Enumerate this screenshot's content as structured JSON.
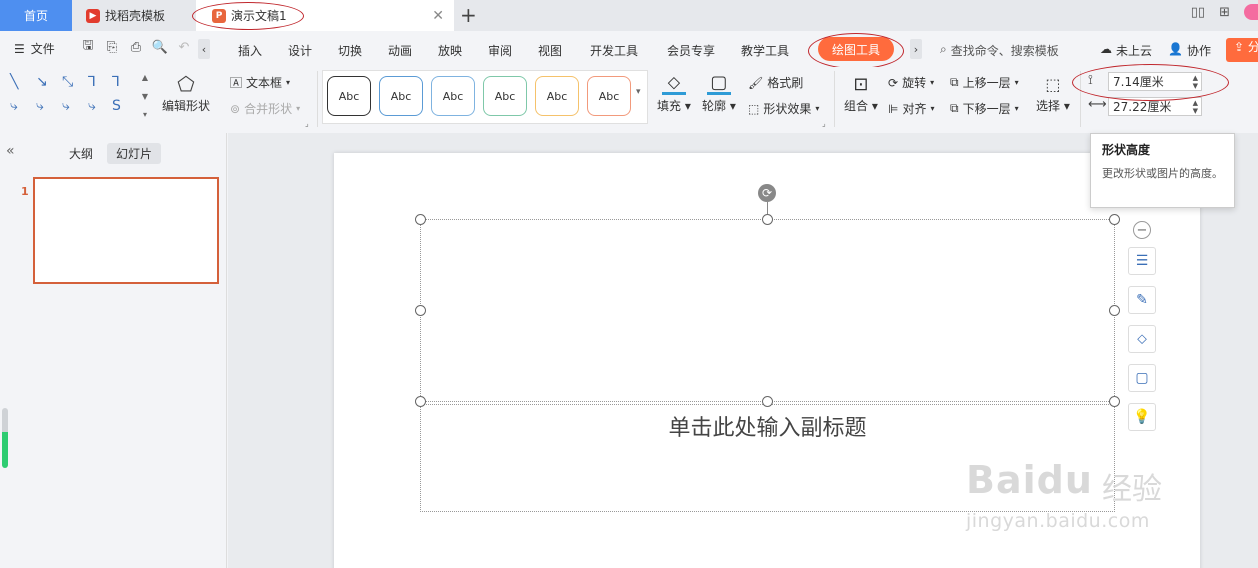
{
  "tabs": {
    "home": "首页",
    "template_tab": "找稻壳模板",
    "doc_tab": "演示文稿1"
  },
  "menu": {
    "file": "文件",
    "items": [
      "插入",
      "设计",
      "切换",
      "动画",
      "放映",
      "审阅",
      "视图",
      "开发工具",
      "会员专享",
      "教学工具"
    ],
    "active": "绘图工具",
    "search": "查找命令、搜索模板",
    "cloud": "未上云",
    "coop": "协作",
    "share": "分"
  },
  "ribbon": {
    "edit_shape": "编辑形状",
    "text_box": "文本框",
    "merge_shape": "合并形状",
    "style_labels": [
      "Abc",
      "Abc",
      "Abc",
      "Abc",
      "Abc",
      "Abc"
    ],
    "style_colors": [
      "#333333",
      "#5b9bd5",
      "#7fb3e0",
      "#7fc8a9",
      "#f5c26b",
      "#f29a7c"
    ],
    "fill": "填充",
    "outline": "轮廓",
    "format_painter": "格式刷",
    "shape_effect": "形状效果",
    "group": "组合",
    "rotate": "旋转",
    "align": "对齐",
    "bring_forward": "上移一层",
    "send_backward": "下移一层",
    "select": "选择",
    "height_value": "7.14厘米",
    "width_value": "27.22厘米"
  },
  "left_pane": {
    "outline_tab": "大纲",
    "slides_tab": "幻灯片",
    "slide_number": "1"
  },
  "slide": {
    "subtitle_placeholder": "单击此处输入副标题"
  },
  "tooltip": {
    "title": "形状高度",
    "description": "更改形状或图片的高度。"
  },
  "watermark": {
    "brand": "Baidu",
    "cn": "经验",
    "url": "jingyan.baidu.com"
  },
  "colors": {
    "accent": "#ff6b3d",
    "home_tab": "#4e8ff0",
    "annotation": "#c0272d",
    "slide_border": "#d4603a"
  }
}
